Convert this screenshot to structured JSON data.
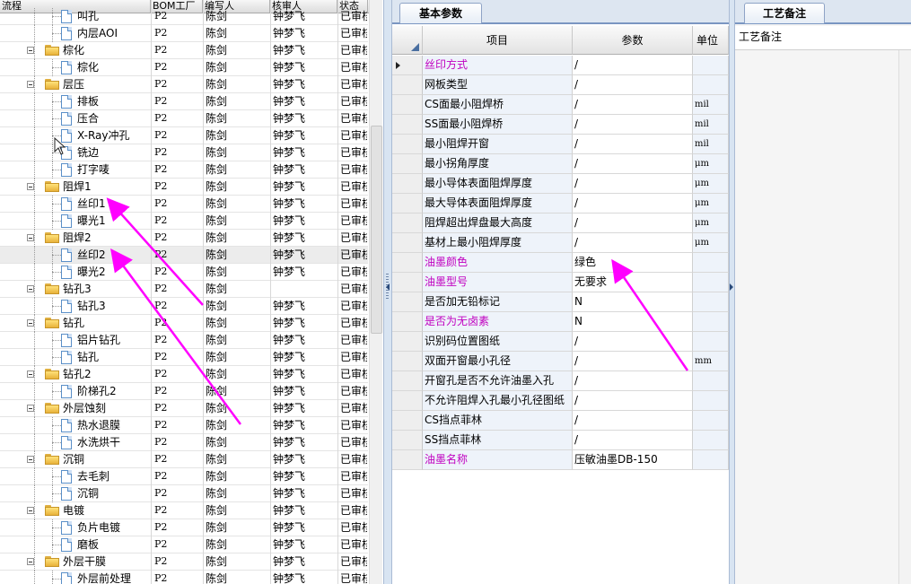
{
  "left_panel": {
    "headers": {
      "flow": "流程",
      "bom": "BOM工厂",
      "editor": "编写人",
      "reviewer": "核审人",
      "status": "状态"
    },
    "rows": [
      {
        "level": 2,
        "text": "叫孔",
        "icon": "doc",
        "bom": "P2",
        "editor": "陈剑",
        "reviewer": "钟梦飞",
        "status": "已审核",
        "partial": true
      },
      {
        "level": 2,
        "text": "内层AOI",
        "icon": "doc",
        "bom": "P2",
        "editor": "陈剑",
        "reviewer": "钟梦飞",
        "status": "已审核"
      },
      {
        "level": 1,
        "text": "棕化",
        "icon": "folder",
        "bom": "P2",
        "editor": "陈剑",
        "reviewer": "钟梦飞",
        "status": "已审核"
      },
      {
        "level": 2,
        "text": "棕化",
        "icon": "doc",
        "bom": "P2",
        "editor": "陈剑",
        "reviewer": "钟梦飞",
        "status": "已审核"
      },
      {
        "level": 1,
        "text": "层压",
        "icon": "folder",
        "bom": "P2",
        "editor": "陈剑",
        "reviewer": "钟梦飞",
        "status": "已审核"
      },
      {
        "level": 2,
        "text": "排板",
        "icon": "doc",
        "bom": "P2",
        "editor": "陈剑",
        "reviewer": "钟梦飞",
        "status": "已审核"
      },
      {
        "level": 2,
        "text": "压合",
        "icon": "doc",
        "bom": "P2",
        "editor": "陈剑",
        "reviewer": "钟梦飞",
        "status": "已审核"
      },
      {
        "level": 2,
        "text": "X-Ray冲孔",
        "icon": "doc",
        "bom": "P2",
        "editor": "陈剑",
        "reviewer": "钟梦飞",
        "status": "已审核"
      },
      {
        "level": 2,
        "text": "铣边",
        "icon": "doc",
        "bom": "P2",
        "editor": "陈剑",
        "reviewer": "钟梦飞",
        "status": "已审核"
      },
      {
        "level": 2,
        "text": "打字唛",
        "icon": "doc",
        "bom": "P2",
        "editor": "陈剑",
        "reviewer": "钟梦飞",
        "status": "已审核"
      },
      {
        "level": 1,
        "text": "阻焊1",
        "icon": "folder",
        "bom": "P2",
        "editor": "陈剑",
        "reviewer": "钟梦飞",
        "status": "已审核"
      },
      {
        "level": 2,
        "text": "丝印1",
        "icon": "doc",
        "bom": "P2",
        "editor": "陈剑",
        "reviewer": "钟梦飞",
        "status": "已审核"
      },
      {
        "level": 2,
        "text": "曝光1",
        "icon": "doc",
        "bom": "P2",
        "editor": "陈剑",
        "reviewer": "钟梦飞",
        "status": "已审核"
      },
      {
        "level": 1,
        "text": "阻焊2",
        "icon": "folder",
        "bom": "P2",
        "editor": "陈剑",
        "reviewer": "钟梦飞",
        "status": "已审核"
      },
      {
        "level": 2,
        "text": "丝印2",
        "icon": "doc",
        "bom": "P2",
        "editor": "陈剑",
        "reviewer": "钟梦飞",
        "status": "已审核",
        "selected": true
      },
      {
        "level": 2,
        "text": "曝光2",
        "icon": "doc",
        "bom": "P2",
        "editor": "陈剑",
        "reviewer": "钟梦飞",
        "status": "已审核"
      },
      {
        "level": 1,
        "text": "钻孔3",
        "icon": "folder",
        "bom": "P2",
        "editor": "陈剑",
        "reviewer": "",
        "status": "已审核"
      },
      {
        "level": 2,
        "text": "钻孔3",
        "icon": "doc",
        "bom": "P2",
        "editor": "陈剑",
        "reviewer": "钟梦飞",
        "status": "已审核"
      },
      {
        "level": 1,
        "text": "钻孔",
        "icon": "folder",
        "bom": "P2",
        "editor": "陈剑",
        "reviewer": "钟梦飞",
        "status": "已审核"
      },
      {
        "level": 2,
        "text": "铝片钻孔",
        "icon": "doc",
        "bom": "P2",
        "editor": "陈剑",
        "reviewer": "钟梦飞",
        "status": "已审核"
      },
      {
        "level": 2,
        "text": "钻孔",
        "icon": "doc",
        "bom": "P2",
        "editor": "陈剑",
        "reviewer": "钟梦飞",
        "status": "已审核"
      },
      {
        "level": 1,
        "text": "钻孔2",
        "icon": "folder",
        "bom": "P2",
        "editor": "陈剑",
        "reviewer": "钟梦飞",
        "status": "已审核"
      },
      {
        "level": 2,
        "text": "阶梯孔2",
        "icon": "doc",
        "bom": "P2",
        "editor": "陈剑",
        "reviewer": "钟梦飞",
        "status": "已审核"
      },
      {
        "level": 1,
        "text": "外层蚀刻",
        "icon": "folder",
        "bom": "P2",
        "editor": "陈剑",
        "reviewer": "钟梦飞",
        "status": "已审核"
      },
      {
        "level": 2,
        "text": "热水退膜",
        "icon": "doc",
        "bom": "P2",
        "editor": "陈剑",
        "reviewer": "钟梦飞",
        "status": "已审核"
      },
      {
        "level": 2,
        "text": "水洗烘干",
        "icon": "doc",
        "bom": "P2",
        "editor": "陈剑",
        "reviewer": "钟梦飞",
        "status": "已审核"
      },
      {
        "level": 1,
        "text": "沉铜",
        "icon": "folder",
        "bom": "P2",
        "editor": "陈剑",
        "reviewer": "钟梦飞",
        "status": "已审核"
      },
      {
        "level": 2,
        "text": "去毛刺",
        "icon": "doc",
        "bom": "P2",
        "editor": "陈剑",
        "reviewer": "钟梦飞",
        "status": "已审核"
      },
      {
        "level": 2,
        "text": "沉铜",
        "icon": "doc",
        "bom": "P2",
        "editor": "陈剑",
        "reviewer": "钟梦飞",
        "status": "已审核"
      },
      {
        "level": 1,
        "text": "电镀",
        "icon": "folder",
        "bom": "P2",
        "editor": "陈剑",
        "reviewer": "钟梦飞",
        "status": "已审核"
      },
      {
        "level": 2,
        "text": "负片电镀",
        "icon": "doc",
        "bom": "P2",
        "editor": "陈剑",
        "reviewer": "钟梦飞",
        "status": "已审核"
      },
      {
        "level": 2,
        "text": "磨板",
        "icon": "doc",
        "bom": "P2",
        "editor": "陈剑",
        "reviewer": "钟梦飞",
        "status": "已审核"
      },
      {
        "level": 1,
        "text": "外层干膜",
        "icon": "folder",
        "bom": "P2",
        "editor": "陈剑",
        "reviewer": "钟梦飞",
        "status": "已审核"
      },
      {
        "level": 2,
        "text": "外层前处理",
        "icon": "doc",
        "bom": "P2",
        "editor": "陈剑",
        "reviewer": "钟梦飞",
        "status": "已审核"
      }
    ]
  },
  "middle_panel": {
    "tab_label": "基本参数",
    "headers": {
      "item": "项目",
      "value": "参数",
      "unit": "单位"
    },
    "highlight_color": "#c000c0",
    "rows": [
      {
        "item": "丝印方式",
        "value": "/",
        "unit": "",
        "highlight": true,
        "current": true
      },
      {
        "item": "网板类型",
        "value": "/",
        "unit": ""
      },
      {
        "item": "CS面最小阻焊桥",
        "value": "/",
        "unit": "mil"
      },
      {
        "item": "SS面最小阻焊桥",
        "value": "/",
        "unit": "mil"
      },
      {
        "item": "最小阻焊开窗",
        "value": "/",
        "unit": "mil"
      },
      {
        "item": "最小拐角厚度",
        "value": "/",
        "unit": "μm"
      },
      {
        "item": "最小导体表面阻焊厚度",
        "value": "/",
        "unit": "μm"
      },
      {
        "item": "最大导体表面阻焊厚度",
        "value": "/",
        "unit": "μm"
      },
      {
        "item": "阻焊超出焊盘最大高度",
        "value": "/",
        "unit": "μm"
      },
      {
        "item": "基材上最小阻焊厚度",
        "value": "/",
        "unit": "μm"
      },
      {
        "item": "油墨颜色",
        "value": "绿色",
        "unit": "",
        "highlight": true
      },
      {
        "item": "油墨型号",
        "value": "无要求",
        "unit": "",
        "highlight": true
      },
      {
        "item": "是否加无铅标记",
        "value": "N",
        "unit": ""
      },
      {
        "item": "是否为无卤素",
        "value": "N",
        "unit": "",
        "highlight": true
      },
      {
        "item": "识别码位置图纸",
        "value": "/",
        "unit": ""
      },
      {
        "item": "双面开窗最小孔径",
        "value": "/",
        "unit": "mm"
      },
      {
        "item": "开窗孔是否不允许油墨入孔",
        "value": "/",
        "unit": ""
      },
      {
        "item": "不允许阻焊入孔最小孔径图纸",
        "value": "/",
        "unit": ""
      },
      {
        "item": "CS挡点菲林",
        "value": "/",
        "unit": ""
      },
      {
        "item": "SS挡点菲林",
        "value": "/",
        "unit": ""
      },
      {
        "item": "油墨名称",
        "value": "压敏油墨DB-150",
        "unit": "",
        "highlight": true
      }
    ]
  },
  "right_panel": {
    "tab_label": "工艺备注",
    "label": "工艺备注"
  },
  "annotation_color": "#ff00ff"
}
